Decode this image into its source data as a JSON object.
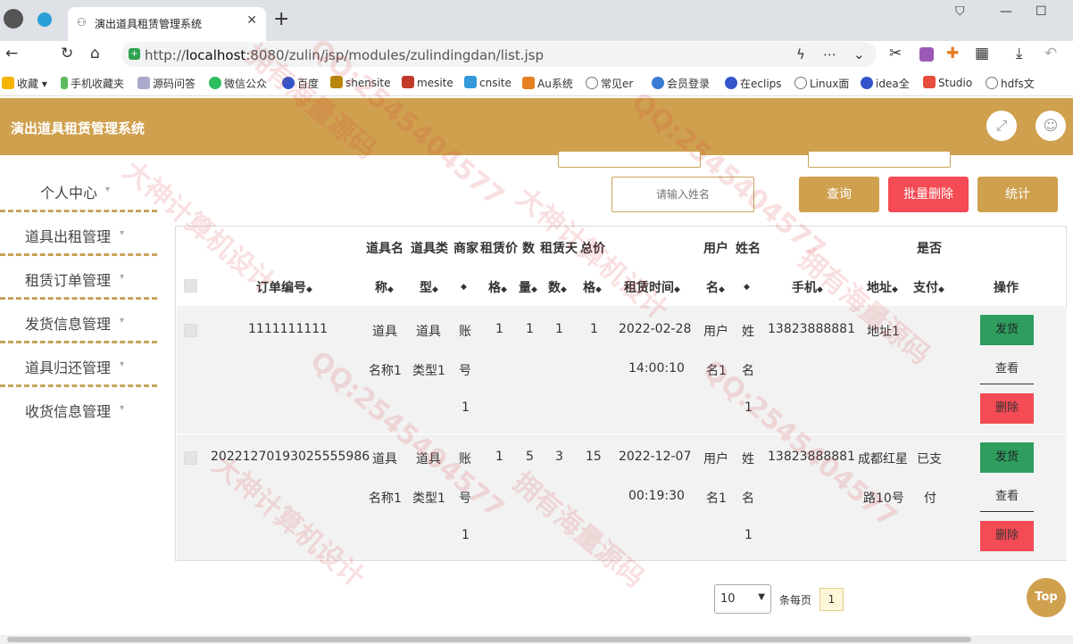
{
  "browser": {
    "tab_title": "演出道具租赁管理系统",
    "url_host": "localhost",
    "url_prefix": "http://",
    "url_rest": ":8080/zulin/jsp/modules/zulindingdan/list.jsp",
    "bookmarks": [
      "收藏",
      "手机收藏夹",
      "源码问答",
      "微信公众",
      "百度",
      "shensite",
      "mesite",
      "cnsite",
      "Au系统",
      "常见er",
      "会员登录",
      "在eclips",
      "Linux面",
      "idea全",
      "Studio",
      "hdfs文"
    ]
  },
  "app": {
    "title": "演出道具租赁管理系统"
  },
  "sidebar": {
    "items": [
      {
        "label": "个人中心"
      },
      {
        "label": "道具出租管理"
      },
      {
        "label": "租赁订单管理"
      },
      {
        "label": "发货信息管理"
      },
      {
        "label": "道具归还管理"
      },
      {
        "label": "收货信息管理"
      }
    ]
  },
  "search": {
    "name_placeholder": "请输入姓名"
  },
  "buttons": {
    "query": "查询",
    "batch_delete": "批量删除",
    "stats": "统计"
  },
  "table": {
    "headers_top": {
      "prop_name": "道具名",
      "prop_type": "道具类",
      "merchant": "商家",
      "price": "租赁价",
      "qty": "数",
      "days": "租赁天",
      "total": "总价",
      "username": "用户",
      "name": "姓名",
      "paid": "是否"
    },
    "headers_bottom": {
      "order_no": "订单编号",
      "prop_name": "称",
      "prop_type": "型",
      "merchant": "",
      "price": "格",
      "qty": "量",
      "days": "数",
      "total": "格",
      "rent_time": "租赁时间",
      "username": "名",
      "name": "",
      "phone": "手机",
      "address": "地址",
      "paid": "支付",
      "ops": "操作"
    },
    "rows": [
      {
        "order_no": "1111111111",
        "prop_name": [
          "道具",
          "名称1"
        ],
        "prop_type": [
          "道具",
          "类型1"
        ],
        "merchant": [
          "账",
          "号",
          "1"
        ],
        "price": "1",
        "qty": "1",
        "days": "1",
        "total": "1",
        "rent_time": [
          "2022-02-28",
          "14:00:10"
        ],
        "username": [
          "用户",
          "名1"
        ],
        "name": [
          "姓",
          "名",
          "1"
        ],
        "phone": "13823888881",
        "address": [
          "地址1"
        ],
        "paid": [
          "",
          ""
        ],
        "ops": {
          "ship": "发货",
          "view": "查看",
          "delete": "删除"
        }
      },
      {
        "order_no": "20221270193025555986",
        "prop_name": [
          "道具",
          "名称1"
        ],
        "prop_type": [
          "道具",
          "类型1"
        ],
        "merchant": [
          "账",
          "号",
          "1"
        ],
        "price": "1",
        "qty": "5",
        "days": "3",
        "total": "15",
        "rent_time": [
          "2022-12-07",
          "00:19:30"
        ],
        "username": [
          "用户",
          "名1"
        ],
        "name": [
          "姓",
          "名",
          "1"
        ],
        "phone": "13823888881",
        "address": [
          "成都红星",
          "路10号"
        ],
        "paid": [
          "已支",
          "付"
        ],
        "ops": {
          "ship": "发货",
          "view": "查看",
          "delete": "删除"
        }
      }
    ]
  },
  "pager": {
    "page_size": "10",
    "per_page_label": "条每页",
    "current_page": "1"
  },
  "back_to_top": "Top",
  "watermarks": [
    "QQ:2545404577",
    "大神计算机设计",
    "拥有海量源码"
  ],
  "colors": {
    "accent": "#cfa04e",
    "danger": "#f44b55",
    "success": "#2e9d5e"
  }
}
